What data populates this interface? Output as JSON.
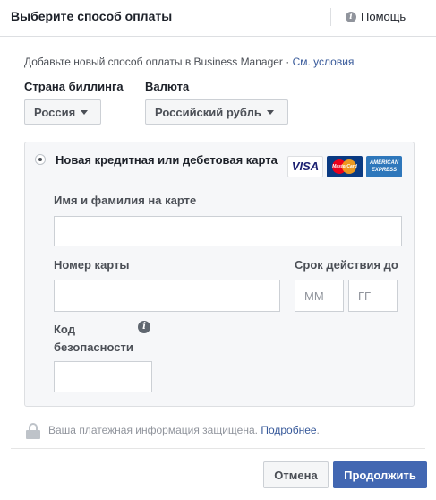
{
  "header": {
    "title": "Выберите способ оплаты",
    "help_label": "Помощь",
    "help_icon": "info-icon"
  },
  "intro": {
    "text": "Добавьте новый способ оплаты в Business Manager · ",
    "terms_link": "См. условия"
  },
  "billing": {
    "country_label": "Страна биллинга",
    "country_value": "Россия",
    "currency_label": "Валюта",
    "currency_value": "Российский рубль"
  },
  "card": {
    "option_label": "Новая кредитная или дебетовая карта",
    "selected": true,
    "logos": {
      "visa": "VISA",
      "mastercard": "MasterCard",
      "amex_top": "AMERICAN",
      "amex_bottom": "EXPRESS"
    },
    "name_label": "Имя и фамилия на карте",
    "name_value": "",
    "number_label": "Номер карты",
    "number_value": "",
    "expiry_label": "Срок действия до",
    "month_placeholder": "ММ",
    "year_placeholder": "ГГ",
    "cvc_label": "Код безопасности",
    "cvc_value": ""
  },
  "security": {
    "text": "Ваша платежная информация защищена. ",
    "link": "Подробнее",
    "suffix": "."
  },
  "buttons": {
    "cancel": "Отмена",
    "continue": "Продолжить"
  },
  "colors": {
    "primary": "#4267b2",
    "link": "#365899",
    "panel_bg": "#f6f7f9",
    "muted_text": "#90949c"
  }
}
